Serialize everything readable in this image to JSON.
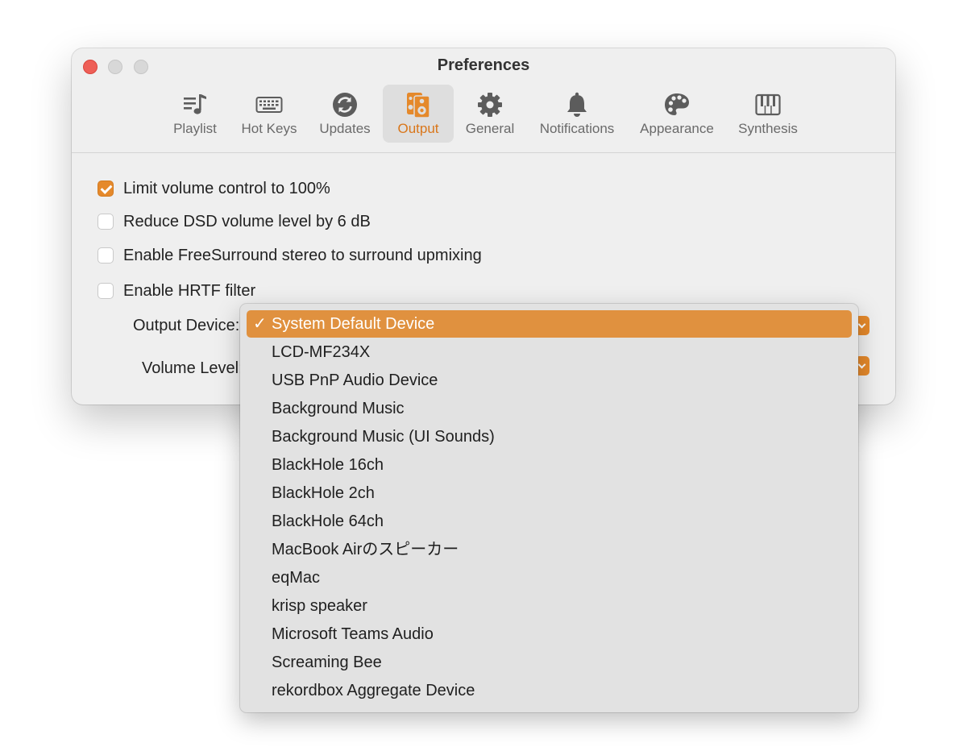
{
  "window": {
    "title": "Preferences"
  },
  "tabs": [
    {
      "label": "Playlist",
      "icon": "playlist-icon"
    },
    {
      "label": "Hot Keys",
      "icon": "keyboard-icon"
    },
    {
      "label": "Updates",
      "icon": "updates-icon"
    },
    {
      "label": "Output",
      "icon": "speaker-icon",
      "selected": true
    },
    {
      "label": "General",
      "icon": "gear-icon"
    },
    {
      "label": "Notifications",
      "icon": "bell-icon"
    },
    {
      "label": "Appearance",
      "icon": "palette-icon"
    },
    {
      "label": "Synthesis",
      "icon": "piano-icon"
    }
  ],
  "options": [
    {
      "label": "Limit volume control to 100%",
      "checked": true
    },
    {
      "label": "Reduce DSD volume level by 6 dB",
      "checked": false
    },
    {
      "label": "Enable FreeSurround stereo to surround upmixing",
      "checked": false
    },
    {
      "label": "Enable HRTF filter",
      "checked": false
    }
  ],
  "fields": {
    "output_device_label": "Output Device:",
    "volume_level_label": "Volume Level:"
  },
  "menu": {
    "checkmark": "✓",
    "items": [
      {
        "label": "System Default Device",
        "selected": true
      },
      {
        "label": "LCD-MF234X"
      },
      {
        "label": "USB PnP Audio Device"
      },
      {
        "label": "Background Music"
      },
      {
        "label": "Background Music (UI Sounds)"
      },
      {
        "label": "BlackHole 16ch"
      },
      {
        "label": "BlackHole 2ch"
      },
      {
        "label": "BlackHole 64ch"
      },
      {
        "label": "MacBook Airのスピーカー"
      },
      {
        "label": "eqMac"
      },
      {
        "label": "krisp speaker"
      },
      {
        "label": "Microsoft Teams Audio"
      },
      {
        "label": "Screaming Bee"
      },
      {
        "label": "rekordbox Aggregate Device"
      }
    ]
  },
  "colors": {
    "accent": "#e5892b",
    "menu_highlight": "#e0913f",
    "window_bg": "#efefef",
    "menu_bg": "#e2e2e2"
  }
}
